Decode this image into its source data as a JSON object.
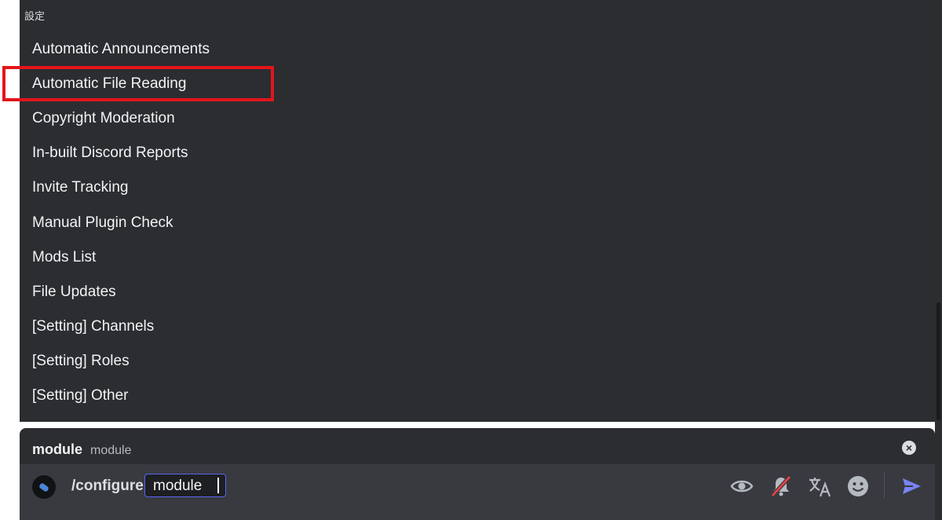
{
  "section_header": "設定",
  "options": [
    {
      "label": "Automatic Announcements"
    },
    {
      "label": "Automatic File Reading"
    },
    {
      "label": "Copyright Moderation"
    },
    {
      "label": "In-built Discord Reports"
    },
    {
      "label": "Invite Tracking"
    },
    {
      "label": "Manual Plugin Check"
    },
    {
      "label": "Mods List"
    },
    {
      "label": "File Updates"
    },
    {
      "label": "[Setting] Channels"
    },
    {
      "label": "[Setting] Roles"
    },
    {
      "label": "[Setting] Other"
    }
  ],
  "highlighted_option": "Automatic File Reading",
  "option_header": {
    "name": "module",
    "description": "module"
  },
  "input": {
    "command": "/configure",
    "chip_value": "module"
  },
  "icons": {
    "close": "close-icon",
    "eye": "eye-icon",
    "bell_off": "bell-slash-icon",
    "translate": "translate-icon",
    "emoji": "emoji-icon",
    "send": "send-icon"
  },
  "colors": {
    "highlight": "#e3151b",
    "accent": "#5865f2",
    "send": "#7984f5"
  }
}
